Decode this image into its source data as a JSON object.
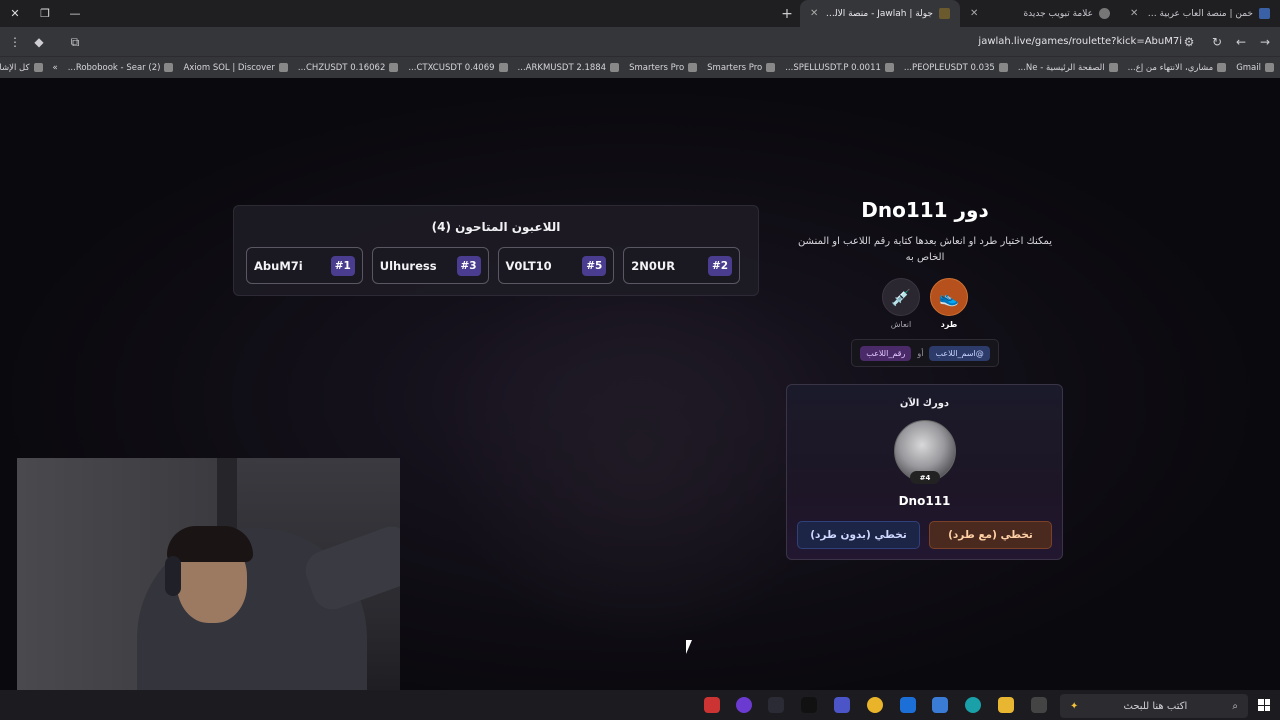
{
  "browser": {
    "tabs": [
      {
        "title": "خمن | منصة ألعاب عربية جماعية",
        "active": false
      },
      {
        "title": "علامة تبويب جديدة",
        "active": false
      },
      {
        "title": "جولة | Jawlah - منصة الألعاب ال...",
        "active": true
      }
    ],
    "url": "jawlah.live/games/roulette?kick=AbuM7i",
    "bookmarks": [
      "Gmail",
      "مشاري، الانتهاء من إع...",
      "الصفحة الرئيسية - Ne...",
      "PEOPLEUSDT 0.035...",
      "SPELLUSDT.P 0.0011...",
      "Smarters Pro",
      "Smarters Pro",
      "ARKMUSDT 2.1884...",
      "CTXCUSDT 0.4069...",
      "CHZUSDT 0.16062...",
      "Axiom SOL | Discover",
      "(2) Robobook - Sear...",
      "كل الإشارات المرجعية"
    ]
  },
  "players_panel": {
    "title": "اللاعبون المتاحون (4)",
    "players": [
      {
        "name": "AbuM7i",
        "number": "#1"
      },
      {
        "name": "Ulhuress",
        "number": "#3"
      },
      {
        "name": "V0LT10",
        "number": "#5"
      },
      {
        "name": "2N0UR",
        "number": "#2"
      }
    ]
  },
  "turn": {
    "title": "دور Dno111",
    "instructions": "يمكنك اختيار طرد او انعاش بعدها كتابة رقم اللاعب او المنشن الخاص به",
    "actions": [
      {
        "label": "طرد",
        "icon": "kick-icon",
        "selected": true
      },
      {
        "label": "انعاش",
        "icon": "revive-icon",
        "selected": false
      }
    ],
    "tag_name": "@اسم_اللاعب",
    "tag_or": "أو",
    "tag_number": "رقم_اللاعب"
  },
  "current": {
    "label": "دورك الآن",
    "badge": "#4",
    "name": "Dno111",
    "kick_button": "تخطي (مع طرد)",
    "skip_button": "تخطي (بدون طرد)"
  },
  "taskbar": {
    "search_placeholder": "اكتب هنا للبحث"
  },
  "colors": {
    "accent": "#4a3c8e",
    "kick": "#b6501c",
    "background": "#0b0a0f"
  }
}
